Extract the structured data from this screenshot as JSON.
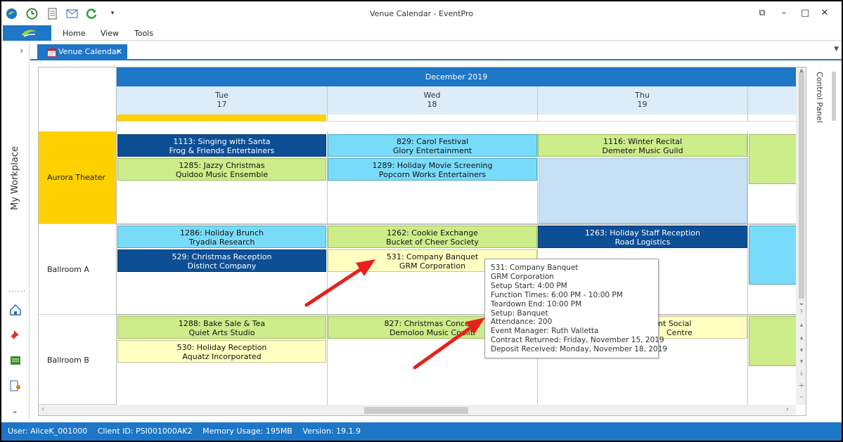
{
  "window": {
    "title": "Venue Calendar - EventPro"
  },
  "ribbon": {
    "tabs": [
      "Home",
      "View",
      "Tools"
    ]
  },
  "sidebar": {
    "label": "My Workplace"
  },
  "document_tab": {
    "label": "Venue Calendar"
  },
  "calendar": {
    "month": "December 2019",
    "days": [
      {
        "name": "Tue",
        "date": "17"
      },
      {
        "name": "Wed",
        "date": "18"
      },
      {
        "name": "Thu",
        "date": "19"
      }
    ],
    "resources": [
      "Aurora Theater",
      "Ballroom A",
      "Ballroom B"
    ],
    "events": {
      "e1113": {
        "line1": "1113: Singing with Santa",
        "line2": "Frog & Friends Entertainers"
      },
      "e829": {
        "line1": "829: Carol Festival",
        "line2": "Glory Entertainment"
      },
      "e1116": {
        "line1": "1116: Winter Recital",
        "line2": "Demeter Music Guild"
      },
      "e1285": {
        "line1": "1285: Jazzy Christmas",
        "line2": "Quidoo Music Ensemble"
      },
      "e1289": {
        "line1": "1289: Holiday Movie Screening",
        "line2": "Popcorn Works Entertainers"
      },
      "e1286": {
        "line1": "1286: Holiday Brunch",
        "line2": "Tryadia Research"
      },
      "e1262": {
        "line1": "1262: Cookie Exchange",
        "line2": "Bucket of Cheer Society"
      },
      "e1263": {
        "line1": "1263: Holiday Staff Reception",
        "line2": "Road Logistics"
      },
      "e529": {
        "line1": "529: Christmas Reception",
        "line2": "Distinct Company"
      },
      "e531": {
        "line1": "531: Company Banquet",
        "line2": "GRM Corporation"
      },
      "e1288": {
        "line1": "1288: Bake Sale & Tea",
        "line2": "Quiet Arts Studio"
      },
      "e827": {
        "line1": "827: Christmas Concerto",
        "line2": "Demoloo Music Coaliti"
      },
      "eSocial": {
        "line1": "nt Social",
        "line2": "Centre"
      },
      "e530": {
        "line1": "530: Holiday Reception",
        "line2": "Aquatz Incorporated"
      }
    }
  },
  "control_panel": {
    "label": "Control Panel"
  },
  "tooltip": {
    "lines": [
      "531: Company Banquet",
      "GRM Corporation",
      "Setup Start: 4:00 PM",
      "Function Times: 6:00 PM - 10:00 PM",
      "Teardown End: 10:00 PM",
      "Setup: Banquet",
      "Attendance: 200",
      "Event Manager: Ruth Valletta",
      "Contract Returned: Friday, November 15, 2019",
      "Deposit Received: Monday, November 18, 2019"
    ]
  },
  "statusbar": {
    "user": "User: AliceK_001000",
    "client": "Client ID: PSI001000AK2",
    "memory": "Memory Usage: 195MB",
    "version": "Version: 19.1.9"
  },
  "colors": {
    "accent": "#1e76c6",
    "today": "#ffd100",
    "event_dark": "#0d4f95",
    "event_cyan": "#79dbfa",
    "event_green": "#cdec8a",
    "event_yellow": "#ffffc2",
    "annotation_arrow": "#e8201c"
  }
}
